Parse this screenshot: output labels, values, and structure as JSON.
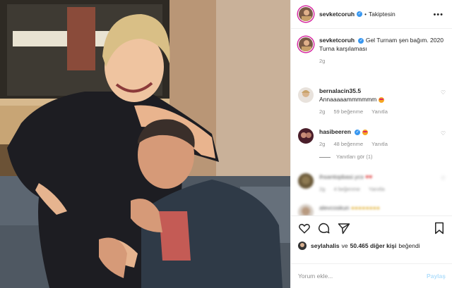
{
  "header": {
    "username": "sevketcoruh",
    "verified_glyph": "✓",
    "follow_label": "Takiptesin",
    "more_glyph": "•••"
  },
  "caption": {
    "username": "sevketcoruh",
    "verified_glyph": "✓",
    "text": "Gel Turnam şen bağım. 2020 Turna karşılaması",
    "time": "2g"
  },
  "comments": [
    {
      "username": "bernalacin35.5",
      "text": "Annaaaaammmmmm",
      "emoji": "heart-eyes-emoji",
      "time": "2g",
      "likes": "59 beğenme",
      "reply": "Yanıtla"
    },
    {
      "username": "hasibeeren",
      "verified_glyph": "✓",
      "emoji": "heart-eyes-emoji",
      "time": "2g",
      "likes": "48 beğenme",
      "reply": "Yanıtla",
      "view_replies": "Yanıtları gör (1)"
    },
    {
      "username": "ihsantopbasi.ycs",
      "time": "2g",
      "likes": "4 beğenme",
      "reply": "Yanıtla"
    },
    {
      "username": "alevcoskun"
    }
  ],
  "actions": {
    "liker": "seylahalis",
    "likes_joiner": "ve",
    "likes_others": "50.465 diğer kişi",
    "likes_suffix": "beğendi"
  },
  "add_comment": {
    "placeholder": "Yorum ekle...",
    "post_label": "Paylaş"
  },
  "colors": {
    "accent": "#3897f0",
    "muted": "#8e8e8e",
    "text": "#262626",
    "post_disabled": "#b2dffc"
  }
}
